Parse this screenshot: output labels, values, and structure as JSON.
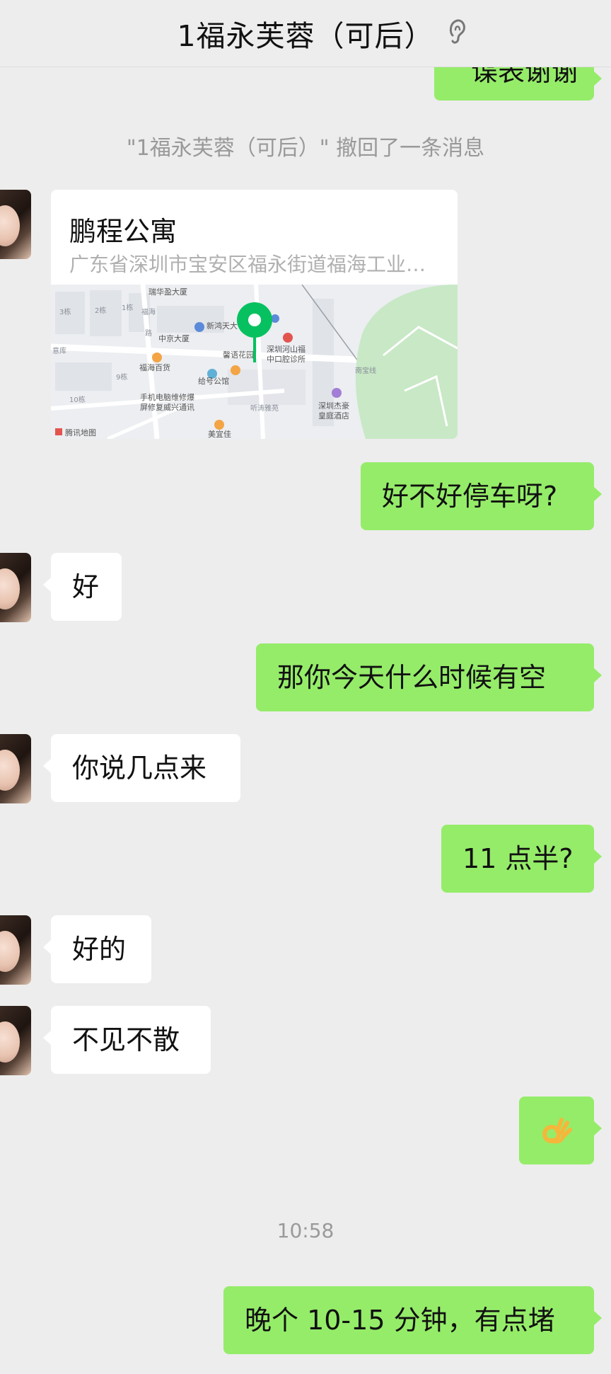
{
  "header": {
    "title": "1福永芙蓉（可后）",
    "ear_icon": "ear-icon"
  },
  "messages": {
    "top_partial": "谍表谢谢",
    "recall_notice": "\"1福永芙蓉（可后）\" 撤回了一条消息",
    "location": {
      "name": "鹏程公寓",
      "address": "广东省深圳市宝安区福永街道福海工业…",
      "map_labels": {
        "l1": "瑞华盈大厦",
        "l2": "新鸿天大",
        "l3": "中京大厦",
        "l4": "馨语花园",
        "l5": "深圳河山福",
        "l6": "中口腔诊所",
        "l7": "福海百货",
        "l8": "给号公馆",
        "l9": "手机电脑维修爆",
        "l10": "屏修复威兴通讯",
        "l11": "听涛雅苑",
        "l12": "深圳杰豪",
        "l13": "皇庭酒店",
        "l14": "美宜佳",
        "l15": "福海",
        "l16": "路",
        "l17": "3栋",
        "l18": "2栋",
        "l19": "1栋",
        "l20": "9栋",
        "l21": "10栋",
        "l22": "意库",
        "l23": "南宝线",
        "watermark": "腾讯地图"
      }
    },
    "m1": "好不好停车呀?",
    "m2": "好",
    "m3": "那你今天什么时候有空",
    "m4": "你说几点来",
    "m5": "11 点半?",
    "m6": "好的",
    "m7": "不见不散",
    "m8_emoji": "ok-hand-icon",
    "time": "10:58",
    "m9": "晚个 10-15 分钟，有点堵"
  },
  "colors": {
    "background": "#ededed",
    "sent_bubble": "#95ec69",
    "received_bubble": "#ffffff",
    "map_pin": "#07c160"
  }
}
